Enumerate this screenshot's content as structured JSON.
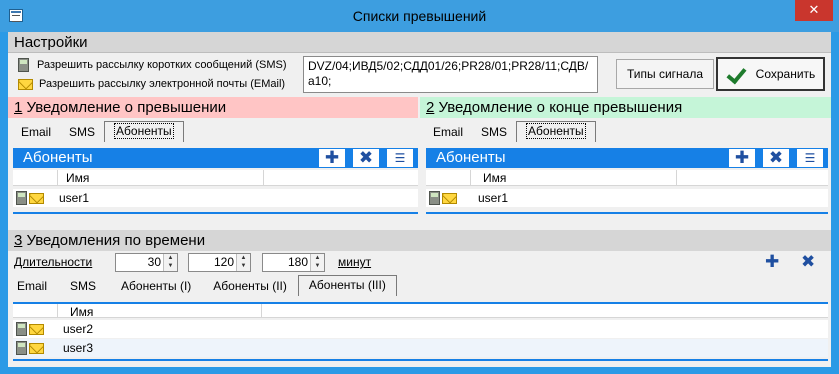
{
  "window": {
    "title": "Списки превышений",
    "close": "✕"
  },
  "settings": {
    "header": "Настройки",
    "sms_label": "Разрешить рассылку коротких сообщений (SMS)",
    "email_label": "Разрешить рассылку электронной почты (EMail)",
    "memo": "DVZ/04;ИВД5/02;СДД01/26;PR28/01;PR28/11;СДВ/a10;",
    "signal_types_button": "Типы сигнала",
    "save_button": "Сохранить"
  },
  "notify": {
    "number": "1",
    "header": " Уведомление о превышении",
    "tabs": [
      "Email",
      "SMS",
      "Абоненты"
    ],
    "grid_title": "Абоненты",
    "column_name": "Имя",
    "rows": [
      {
        "name": "user1"
      }
    ]
  },
  "notify_end": {
    "number": "2",
    "header": " Уведомление о конце превышения",
    "tabs": [
      "Email",
      "SMS",
      "Абоненты"
    ],
    "grid_title": "Абоненты",
    "column_name": "Имя",
    "rows": [
      {
        "name": "user1"
      }
    ]
  },
  "time": {
    "number": "3",
    "header": " Уведомления по времени",
    "durations_label": "Длительности",
    "durations": [
      "30",
      "120",
      "180"
    ],
    "minutes_label": "минут",
    "tabs": [
      "Email",
      "SMS",
      "Абоненты (I)",
      "Абоненты (II)",
      "Абоненты (III)"
    ],
    "column_name": "Имя",
    "rows": [
      {
        "name": "user2"
      },
      {
        "name": "user3"
      }
    ]
  },
  "icons": {
    "add": "✚",
    "delete": "✖"
  },
  "colors": {
    "titlebar": "#3d9ee0",
    "grid_header": "#1680e6",
    "notify_bg": "#ffc5c5",
    "notify_end_bg": "#c5f5d8",
    "close": "#c9362d"
  }
}
